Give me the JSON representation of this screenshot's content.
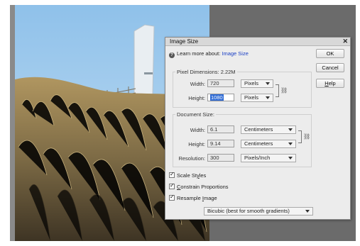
{
  "dialog": {
    "title": "Image Size",
    "close_glyph": "✕",
    "learn_prefix": "Learn more about: ",
    "learn_link": "Image Size",
    "icons": {
      "help": "question-circle-icon",
      "close": "close-icon",
      "link": "chain-link-icon"
    }
  },
  "buttons": {
    "ok": "OK",
    "cancel": "Cancel",
    "help_first": "H",
    "help_rest": "elp"
  },
  "pixel_dimensions": {
    "legend": "Pixel Dimensions:  2.22M",
    "width_label": "Width:",
    "width_value": "720",
    "width_unit": "Pixels",
    "height_label": "Height:",
    "height_value": "1080",
    "height_unit": "Pixels"
  },
  "document_size": {
    "legend": "Document Size:",
    "width_label": "Width:",
    "width_value": "6.1",
    "width_unit": "Centimeters",
    "height_label": "Height:",
    "height_value": "9.14",
    "height_unit": "Centimeters",
    "resolution_label": "Resolution:",
    "resolution_value": "300",
    "resolution_unit": "Pixels/Inch"
  },
  "options": {
    "scale_styles_a": "Scale St",
    "scale_styles_u": "y",
    "scale_styles_b": "les",
    "constrain_u": "C",
    "constrain_rest": "onstrain Proportions",
    "resample_a": "Resample ",
    "resample_u": "I",
    "resample_b": "mage",
    "resample_method": "Bicubic (best for smooth gradients)"
  }
}
